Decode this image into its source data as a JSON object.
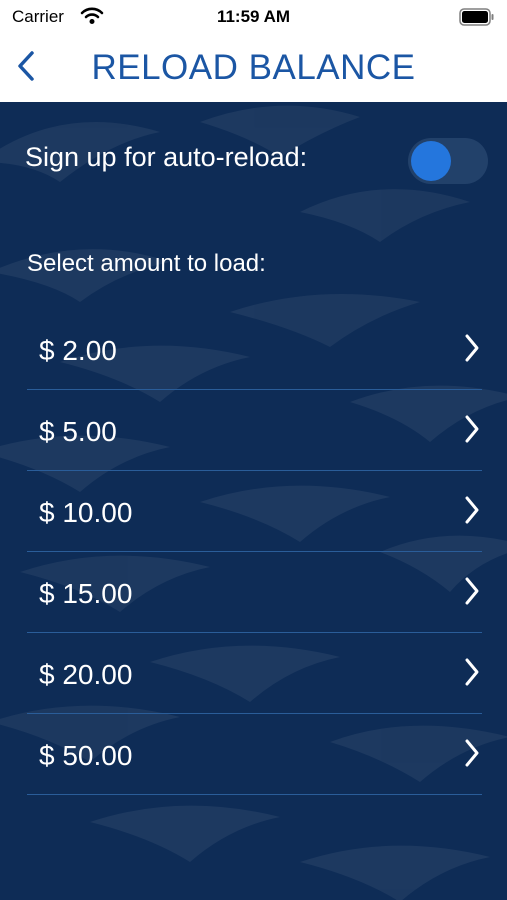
{
  "status_bar": {
    "carrier": "Carrier",
    "time": "11:59 AM",
    "icons": [
      "wifi-icon",
      "battery-icon"
    ]
  },
  "nav": {
    "title": "RELOAD BALANCE",
    "back_icon": "chevron-left-icon"
  },
  "auto_reload": {
    "label": "Sign up for auto-reload:",
    "enabled": false
  },
  "select_label": "Select amount to load:",
  "amounts": [
    {
      "label": "$ 2.00"
    },
    {
      "label": "$ 5.00"
    },
    {
      "label": "$ 10.00"
    },
    {
      "label": "$ 15.00"
    },
    {
      "label": "$ 20.00"
    },
    {
      "label": "$ 50.00"
    }
  ],
  "colors": {
    "accent": "#1b56a4",
    "background": "#0e2c56",
    "toggle_knob": "#2476dd",
    "divider": "#2a5d99"
  }
}
